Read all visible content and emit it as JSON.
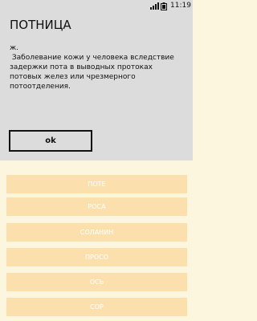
{
  "status_bar": {
    "time": "11:19"
  },
  "dialog": {
    "title": "ПОТНИЦА",
    "message": "ж.\n Заболевание кожи у человека вследствие задержки пота в выводных протоках\nпотовых желез или чрезмерного потоотделения.",
    "ok_label": "ok"
  },
  "list": {
    "items": [
      {
        "label": "ПОТЕ"
      },
      {
        "label": "РОСА"
      },
      {
        "label": "СОЛАНИН"
      },
      {
        "label": "ПРОСО"
      },
      {
        "label": "ОСЬ"
      },
      {
        "label": "СОР"
      }
    ]
  },
  "colors": {
    "page_background": "#fdf6de",
    "list_button": "#fbe0ae",
    "dialog_background": "#dcdcdc"
  }
}
